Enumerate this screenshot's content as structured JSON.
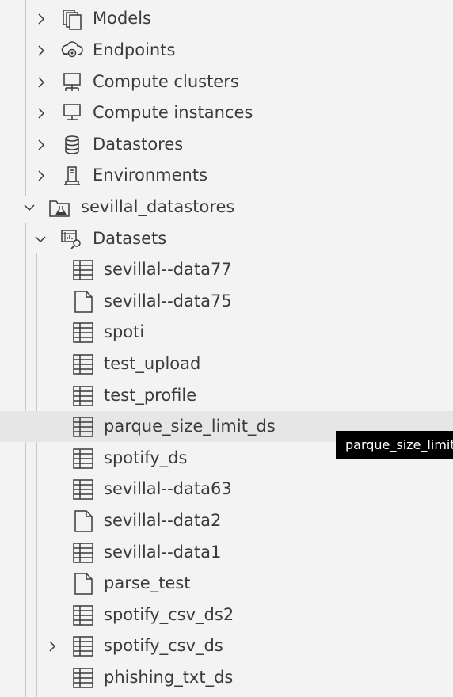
{
  "tree": {
    "top_items": [
      {
        "label": "Models",
        "icon": "models-icon"
      },
      {
        "label": "Endpoints",
        "icon": "endpoints-icon"
      },
      {
        "label": "Compute clusters",
        "icon": "compute-cluster-icon"
      },
      {
        "label": "Compute instances",
        "icon": "compute-instance-icon"
      },
      {
        "label": "Datastores",
        "icon": "database-icon"
      },
      {
        "label": "Environments",
        "icon": "environment-icon"
      }
    ],
    "workspace": {
      "label": "sevillal_datastores",
      "icon": "workspace-flask-icon",
      "expanded": true
    },
    "datasets": {
      "label": "Datasets",
      "icon": "datasets-icon",
      "expanded": true
    },
    "dataset_items": [
      {
        "label": "sevillal--data77",
        "icon": "table-icon"
      },
      {
        "label": "sevillal--data75",
        "icon": "file-icon"
      },
      {
        "label": "spoti",
        "icon": "table-icon"
      },
      {
        "label": "test_upload",
        "icon": "table-icon"
      },
      {
        "label": "test_profile",
        "icon": "table-icon"
      },
      {
        "label": "parque_size_limit_ds",
        "icon": "table-icon",
        "hovered": true
      },
      {
        "label": "spotify_ds",
        "icon": "table-icon"
      },
      {
        "label": "sevillal--data63",
        "icon": "table-icon"
      },
      {
        "label": "sevillal--data2",
        "icon": "file-icon"
      },
      {
        "label": "sevillal--data1",
        "icon": "table-icon"
      },
      {
        "label": "parse_test",
        "icon": "file-icon"
      },
      {
        "label": "spotify_csv_ds2",
        "icon": "table-icon"
      },
      {
        "label": "spotify_csv_ds",
        "icon": "table-icon",
        "collapsed_expander": true
      },
      {
        "label": "phishing_txt_ds",
        "icon": "table-icon"
      }
    ]
  },
  "tooltip": {
    "text": "parque_size_limit_ds"
  },
  "colors": {
    "background": "#f3f3f3",
    "hover": "#e6e6e6",
    "text": "#3b3b3b",
    "tooltip_bg": "#000000",
    "tooltip_text": "#ffffff"
  }
}
